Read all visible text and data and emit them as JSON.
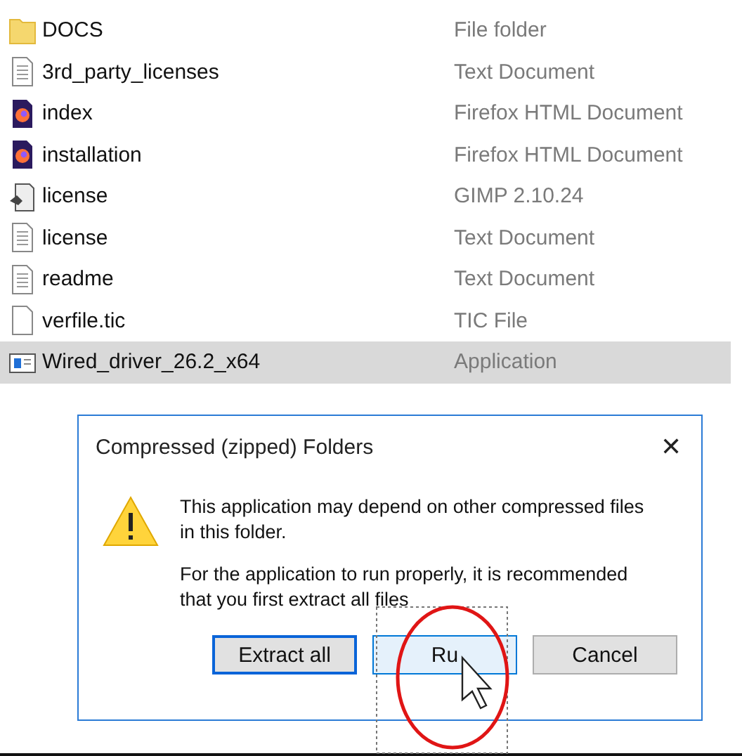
{
  "files": [
    {
      "name": "DOCS",
      "type": "File folder",
      "kind": "folder",
      "selected": false
    },
    {
      "name": "3rd_party_licenses",
      "type": "Text Document",
      "kind": "text",
      "selected": false
    },
    {
      "name": "index",
      "type": "Firefox HTML Document",
      "kind": "firefox",
      "selected": false
    },
    {
      "name": "installation",
      "type": "Firefox HTML Document",
      "kind": "firefox",
      "selected": false
    },
    {
      "name": "license",
      "type": "GIMP 2.10.24",
      "kind": "gimp",
      "selected": false
    },
    {
      "name": "license",
      "type": "Text Document",
      "kind": "text",
      "selected": false
    },
    {
      "name": "readme",
      "type": "Text Document",
      "kind": "text",
      "selected": false
    },
    {
      "name": "verfile.tic",
      "type": "TIC File",
      "kind": "blank",
      "selected": false
    },
    {
      "name": "Wired_driver_26.2_x64",
      "type": "Application",
      "kind": "app",
      "selected": true
    }
  ],
  "dialog": {
    "title": "Compressed (zipped) Folders",
    "close": "✕",
    "messages": [
      "This application may depend on other compressed files in this folder.",
      "For the application to run properly, it is recommended that you first extract all files"
    ],
    "buttons": [
      {
        "label": "Extract all",
        "kind": "default"
      },
      {
        "label": "Ru",
        "kind": "hover"
      },
      {
        "label": "Cancel",
        "kind": "normal"
      }
    ]
  }
}
